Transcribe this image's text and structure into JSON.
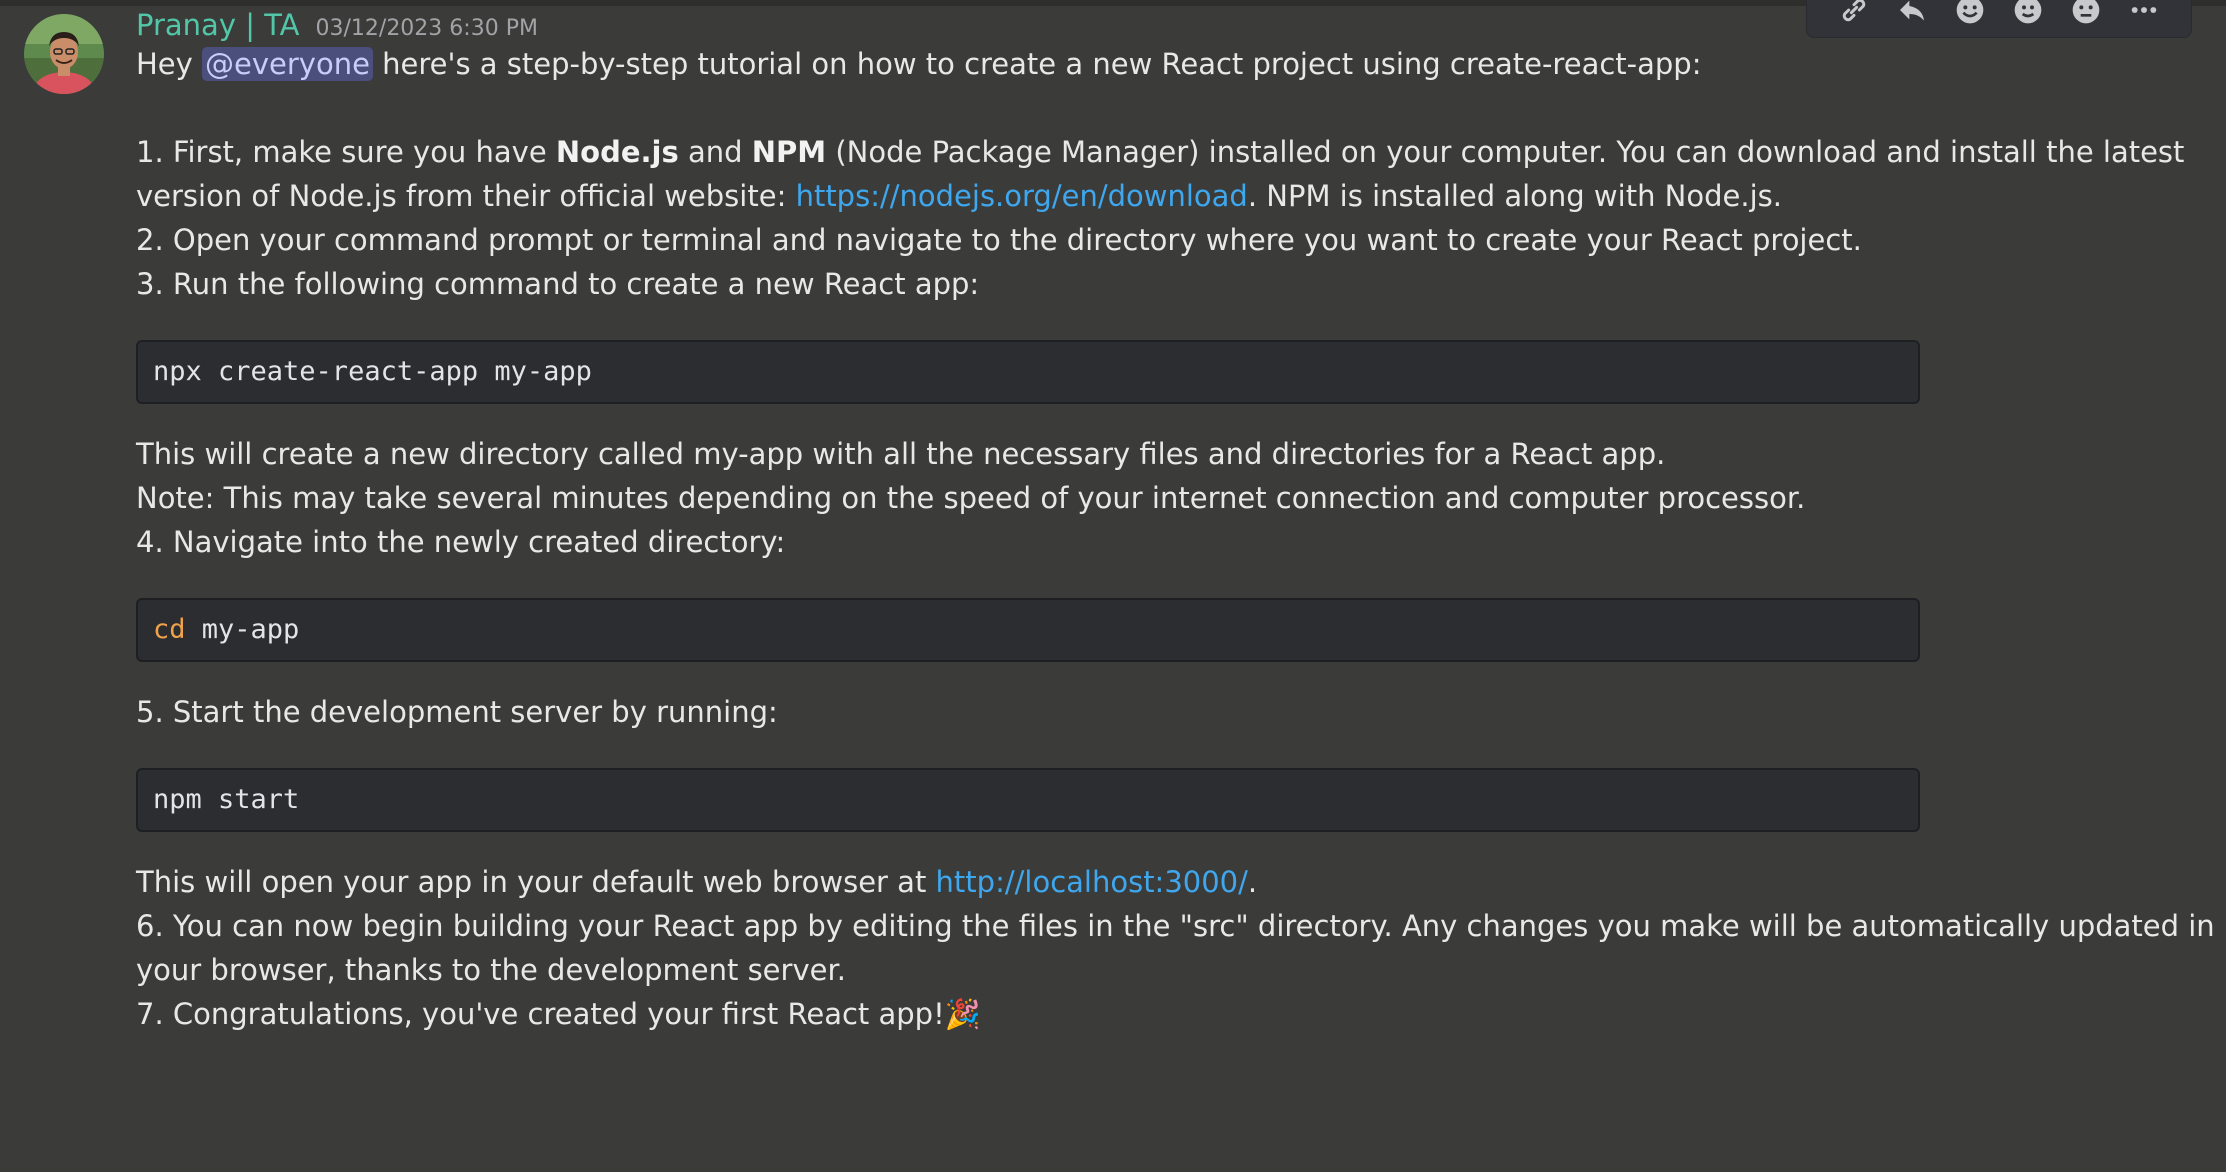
{
  "message": {
    "author": "Pranay | TA",
    "timestamp": "03/12/2023 6:30 PM",
    "author_color": "#52c7a8",
    "intro_before": "Hey ",
    "mention": "@everyone",
    "intro_after": " here's a step-by-step tutorial on how to create a new React project using create-react-app:",
    "step1_a": "1. First, make sure you have ",
    "step1_bold1": "Node.js",
    "step1_b": " and ",
    "step1_bold2": "NPM",
    "step1_c": " (Node Package Manager) installed on your computer. You can download and install the latest",
    "step1_line2_a": "version of Node.js from their official website: ",
    "step1_link": "https://nodejs.org/en/download",
    "step1_line2_b": ". NPM is installed along with Node.js.",
    "step2": "2. Open your command prompt or terminal and navigate to the directory where you want to create your React project.",
    "step3": "3. Run the following command to create a new React app:",
    "code1": "npx create-react-app my-app",
    "after_code1_a": "This will create a new directory called my-app with all the necessary files and directories for a React app.",
    "after_code1_b": "Note: This may take several minutes depending on the speed of your internet connection and computer processor.",
    "step4": "4. Navigate into the newly created directory:",
    "code2_keyword": "cd",
    "code2_rest": " my-app",
    "step5": "5. Start the development server by running:",
    "code3": "npm start",
    "after_code3_a": "This will open your app in your default web browser at ",
    "after_code3_link": "http://localhost:3000/",
    "after_code3_b": ".",
    "step6_a": "6. You can now begin building your React app by editing the files in the \"src\" directory. Any changes you make will be automatically updated in",
    "step6_b": "your browser, thanks to the development server.",
    "step7": "7. Congratulations, you've created your first React app!",
    "step7_emoji": "🎉"
  },
  "toolbar": {
    "icons": [
      "link-icon",
      "reply-icon",
      "add-reaction-icon",
      "emoji-icon",
      "more-reaction-icon",
      "more-options-icon"
    ]
  },
  "colors": {
    "background": "#3b3b3a",
    "link": "#3ea7ee",
    "mention_bg": "#4b4f7c",
    "code_bg": "#2b2d31",
    "code_keyword": "#f0a24a"
  }
}
